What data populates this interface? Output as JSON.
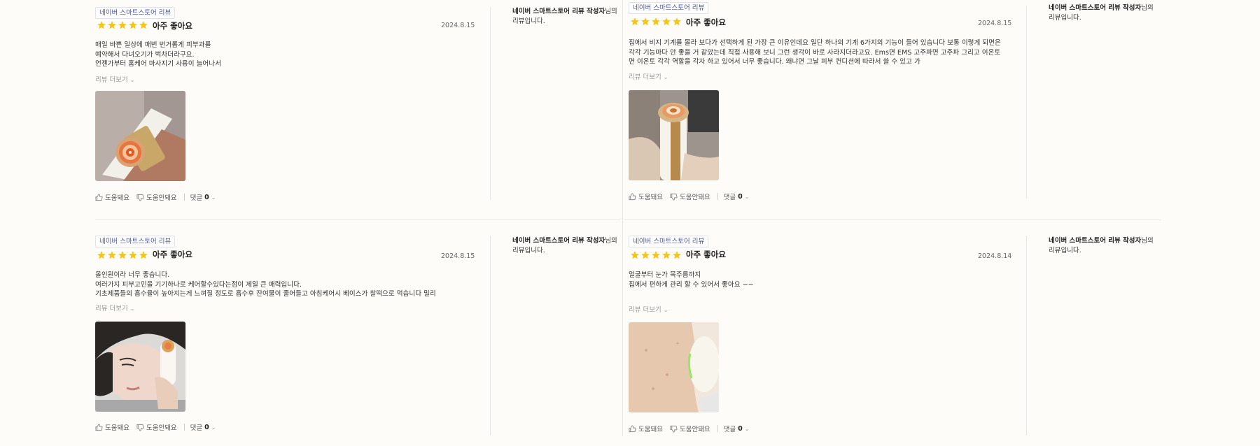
{
  "colors": {
    "star": "#f5c518",
    "badge_text": "#4a55a2",
    "separator": "#e6e6e6",
    "background": "#fdfcf8"
  },
  "reviews": [
    {
      "badge": "네이버 스마트스토어 리뷰",
      "rating_label": "아주 좋아요",
      "stars": 5,
      "date": "2024.8.15",
      "body": "매일 바쁜 일상에 매번 번거롭게 피부과를\n예약해서 다녀오기가 벅차더라구요.\n언젠가부터 홈케어 마사지기 사용이 늘어나서",
      "more": "리뷰 더보기",
      "photo": "device-closeup-photo",
      "helpful": "도움돼요",
      "not_helpful": "도움안돼요",
      "comments_label": "댓글",
      "comments_count": "0",
      "author_name": "네이버 스마트스토어 리뷰 작성자",
      "author_suffix": "님의",
      "author_line2": "리뷰입니다."
    },
    {
      "badge": "네이버 스마트스토어 리뷰",
      "rating_label": "아주 좋아요",
      "stars": 5,
      "date": "2024.8.15",
      "body": "집에서 비지 기계를 몰라 보다가 선택하게 된 가장 큰 이유인데요 일단 하나의 기계 6가지의 기능이 들어 있습니다 보통 이렇게 되면은 각각 기능마다 안 좋을 거 같았는데 직접 사용해 보니 그런 생각이 바로 사라지더라고요. Ems면 EMS 고주파면 고주파 그리고 이온토면 이온토 각각 역할을 각자 하고 있어서 너무 좋습니다. 왜냐면 그날 피부 컨디션에 따라서 쓸 수 있고 가",
      "more": "리뷰 더보기",
      "photo": "device-held-photo",
      "helpful": "도움돼요",
      "not_helpful": "도움안돼요",
      "comments_label": "댓글",
      "comments_count": "0",
      "author_name": "네이버 스마트스토어 리뷰 작성자",
      "author_suffix": "님의",
      "author_line2": "리뷰입니다."
    },
    {
      "badge": "네이버 스마트스토어 리뷰",
      "rating_label": "아주 좋아요",
      "stars": 5,
      "date": "2024.8.15",
      "body": "올인원이라 너무 좋습니다.\n여러가지 피부고민을 기기하나로 케어할수있다는점이 제일 큰 매력입니다.\n기초제품들의 흡수율이 높아지는게 느껴질 정도로 흡수후 잔여물이 줄어들고 아침케어시 베이스가 찰떡으로 먹습니다 밀리",
      "more": "리뷰 더보기",
      "photo": "face-device-photo",
      "helpful": "도움돼요",
      "not_helpful": "도움안돼요",
      "comments_label": "댓글",
      "comments_count": "0",
      "author_name": "네이버 스마트스토어 리뷰 작성자",
      "author_suffix": "님의",
      "author_line2": "리뷰입니다."
    },
    {
      "badge": "네이버 스마트스토어 리뷰",
      "rating_label": "아주 좋아요",
      "stars": 5,
      "date": "2024.8.14",
      "body": "얼굴부터 눈가 목주름까지\n집에서 편하게 관리 할 수 있어서 좋아요 ~~",
      "more": "리뷰 더보기",
      "photo": "skin-device-photo",
      "helpful": "도움돼요",
      "not_helpful": "도움안돼요",
      "comments_label": "댓글",
      "comments_count": "0",
      "author_name": "네이버 스마트스토어 리뷰 작성자",
      "author_suffix": "님의",
      "author_line2": "리뷰입니다."
    }
  ]
}
